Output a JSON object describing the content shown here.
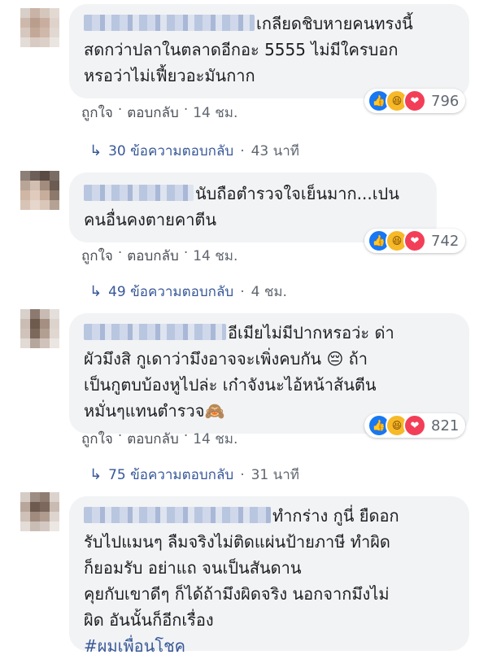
{
  "action_labels": {
    "like": "ถูกใจ",
    "reply": "ตอบกลับ",
    "separator": "·"
  },
  "comments": [
    {
      "body": "เกลียดชิบหายคนทรงนี้\nสดกว่าปลาในตลาดอีกอะ 5555 ไม่มีใครบอก\nหรอว่าไม่เฟี้ยวอะมันกาก",
      "reaction_count": "796",
      "time": "14 ชม.",
      "replies_text": "30 ข้อความตอบกลับ",
      "replies_time": "43 นาที",
      "reaction_icons": [
        "like-icon",
        "haha-icon",
        "love-icon"
      ]
    },
    {
      "body": "นับถือตำรวจใจเย็นมาก...เปน\nคนอื่นคงตายคาตีน",
      "reaction_count": "742",
      "time": "14 ชม.",
      "replies_text": "49 ข้อความตอบกลับ",
      "replies_time": "4 ชม.",
      "reaction_icons": [
        "like-icon",
        "haha-icon",
        "love-icon"
      ]
    },
    {
      "body": "อีเมียไม่มีปากหรอว่ะ ด่า\nผัวมึงสิ กูเดาว่ามึงอาจจะเพิ่งคบกัน 😔 ถ้า\nเป็นกูตบบ้องหูไปล่ะ เก๋าจังนะไอ้หน้าส้นตีน\nหมั่นๆแทนตำรวจ🙈",
      "reaction_count": "821",
      "time": "14 ชม.",
      "replies_text": "75 ข้อความตอบกลับ",
      "replies_time": "31 นาที",
      "reaction_icons": [
        "like-icon",
        "haha-icon",
        "love-icon"
      ]
    },
    {
      "body": "ทำกร่าง กูนี่ ยืดอก\nรับไปแมนๆ ลืมจริงไม่ติดแผ่นป้ายภาษี ทำผิด\nก็ยอมรับ อย่าแถ จนเป็นสันดาน\nคุยกับเขาดีๆ ก็ได้ถ้ามึงผิดจริง นอกจากมึงไม่\nผิด อันนั้นก็อีกเรื่อง",
      "hashtag": "#ผมเพื่อนโชค"
    }
  ],
  "colors": {
    "bubble_bg": "#f2f3f5",
    "link": "#385898",
    "meta": "#606770",
    "like": "#1877f2",
    "haha": "#f7b928",
    "love": "#f33e58"
  }
}
